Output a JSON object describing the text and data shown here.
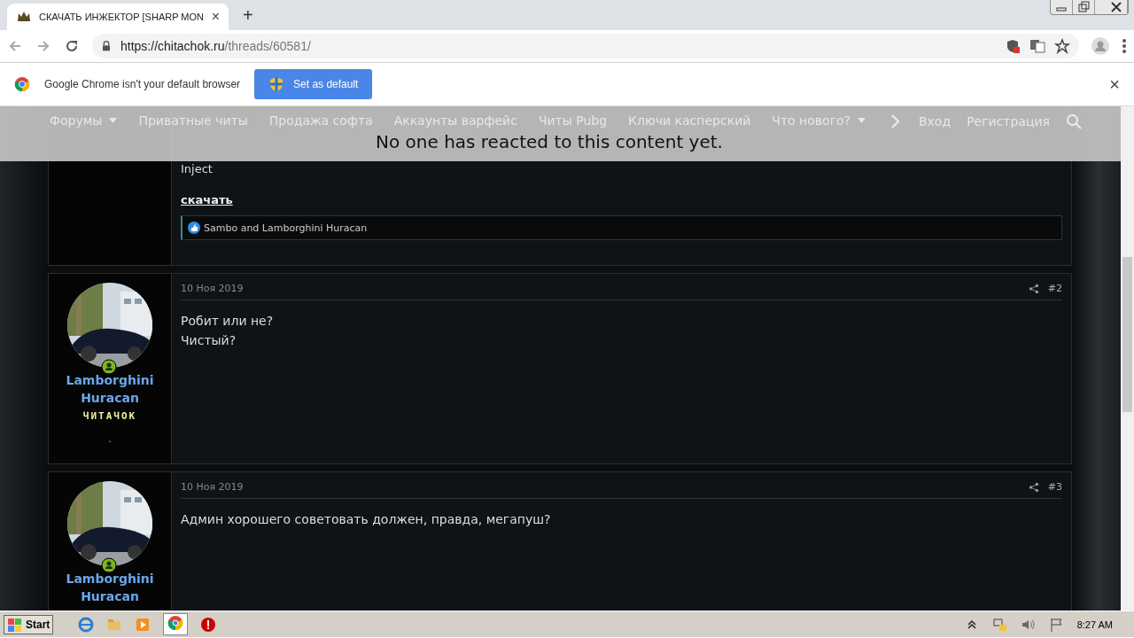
{
  "browser": {
    "tab": {
      "title": "СКАЧАТЬ ИНЖЕКТОР [SHARP MON",
      "close": "×"
    },
    "new_tab": "+",
    "url": {
      "host": "https://chitachok.ru",
      "path": "/threads/60581/"
    }
  },
  "infobar": {
    "message": "Google Chrome isn't your default browser",
    "button": "Set as default",
    "close": "×"
  },
  "nav": {
    "items": [
      {
        "label": "Форумы",
        "dropdown": true
      },
      {
        "label": "Приватные читы",
        "dropdown": false
      },
      {
        "label": "Продажа софта",
        "dropdown": false
      },
      {
        "label": "Аккаунты варфейс",
        "dropdown": false
      },
      {
        "label": "Читы Pubg",
        "dropdown": false
      },
      {
        "label": "Ключи касперский",
        "dropdown": false
      },
      {
        "label": "Что нового?",
        "dropdown": true
      }
    ],
    "login": "Вход",
    "register": "Регистрация"
  },
  "tooltip": "No one has reacted to this content yet.",
  "first_post": {
    "last_line": "Inject",
    "link": "скачать",
    "reactions": "Sambo and Lamborghini Huracan"
  },
  "posts": [
    {
      "author": "Lamborghini Huracan",
      "user_title": "ЧИТАЧОК",
      "footer": ".",
      "online": true,
      "date": "10 Ноя 2019",
      "number": "#2",
      "lines": [
        "Робит или не?",
        "Чистый?"
      ]
    },
    {
      "author": "Lamborghini Huracan",
      "online": true,
      "date": "10 Ноя 2019",
      "number": "#3",
      "lines": [
        "Админ хорошего советовать должен, правда, мегапуш?"
      ]
    }
  ],
  "taskbar": {
    "start": "Start",
    "time": "8:27 AM"
  }
}
